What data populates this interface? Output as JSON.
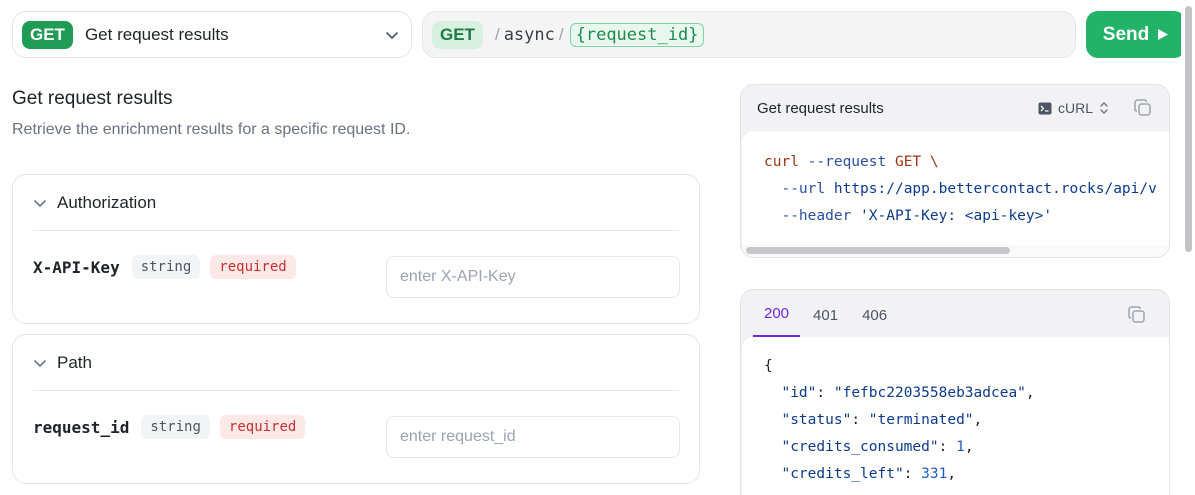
{
  "top": {
    "endpoint_select": {
      "method": "GET",
      "title": "Get request results"
    },
    "url": {
      "method": "GET",
      "segments": [
        "async"
      ],
      "param": "{request_id}"
    },
    "send_label": "Send"
  },
  "main": {
    "title": "Get request results",
    "description": "Retrieve the enrichment results for a specific request ID.",
    "sections": [
      {
        "label": "Authorization",
        "field": {
          "name": "X-API-Key",
          "type": "string",
          "required": "required",
          "placeholder": "enter X-API-Key",
          "value": ""
        }
      },
      {
        "label": "Path",
        "field": {
          "name": "request_id",
          "type": "string",
          "required": "required",
          "placeholder": "enter request_id",
          "value": ""
        }
      }
    ]
  },
  "code_panel": {
    "title": "Get request results",
    "language": "cURL",
    "lines": {
      "l1_cmd": "curl",
      "l1_flag": "--request",
      "l1_rest": " GET \\",
      "l2_flag": "--url",
      "l2_val": " https://app.bettercontact.rocks/api/v",
      "l3_flag": "--header",
      "l3_val": " 'X-API-Key: <api-key>'"
    }
  },
  "response_panel": {
    "tabs": [
      "200",
      "401",
      "406"
    ],
    "active_tab": "200",
    "json": {
      "open": "{",
      "id_key": "\"id\"",
      "id_val": "\"fefbc2203558eb3adcea\"",
      "status_key": "\"status\"",
      "status_val": "\"terminated\"",
      "credits_consumed_key": "\"credits_consumed\"",
      "credits_consumed_val": "1",
      "credits_left_key": "\"credits_left\"",
      "credits_left_val": "331"
    }
  },
  "colors": {
    "accent_green": "#22b368",
    "tab_active": "#6d28d9",
    "required_red": "#c53030"
  }
}
